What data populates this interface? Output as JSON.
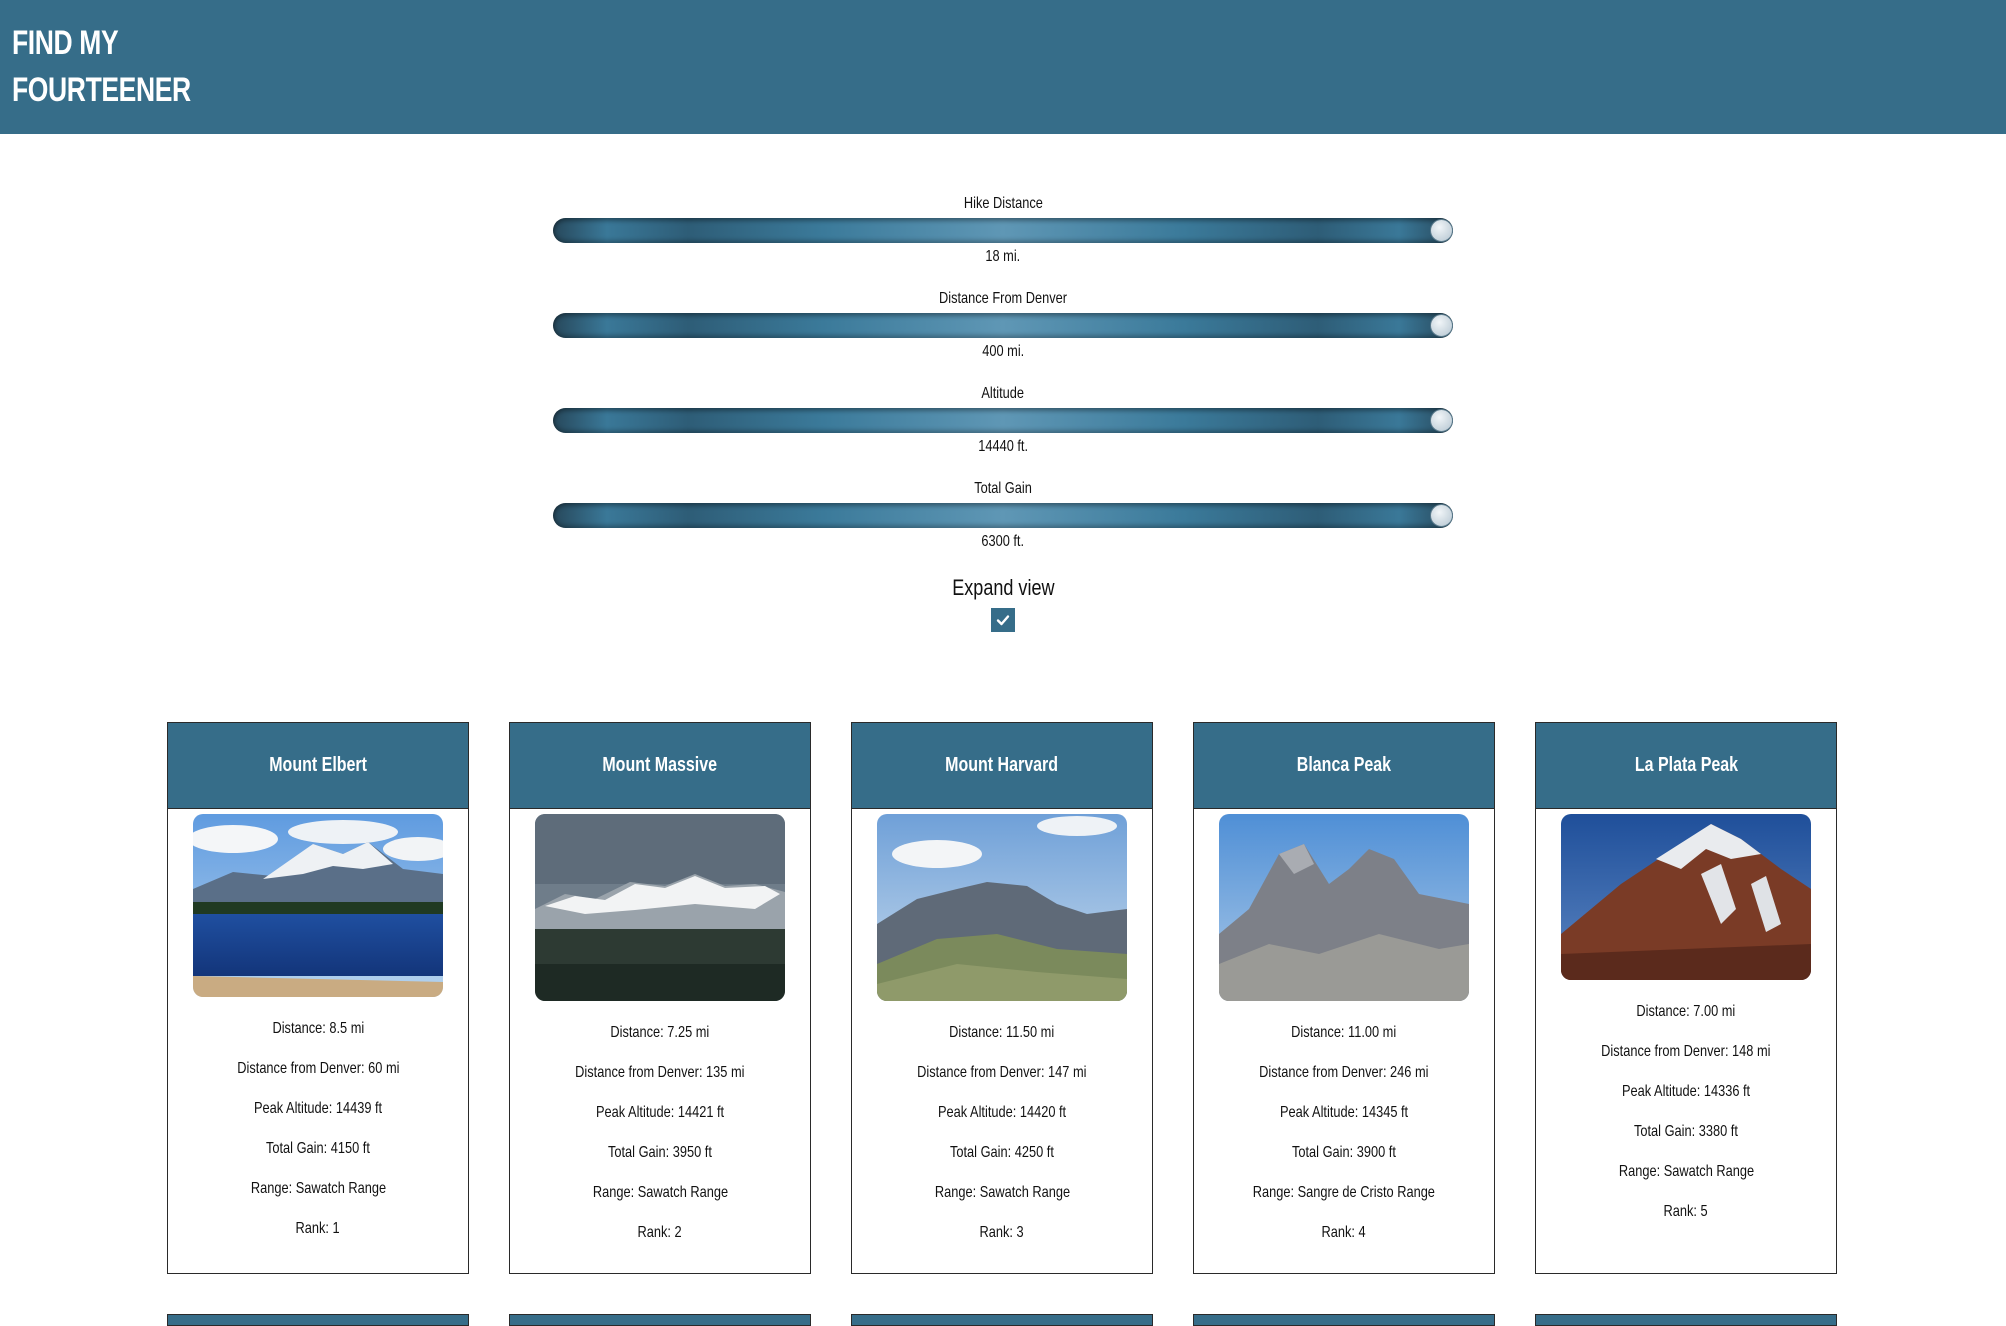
{
  "header": {
    "title_line1": "FIND MY",
    "title_line2": "FOURTEENER"
  },
  "sliders": [
    {
      "label": "Hike Distance",
      "value_text": "18 mi.",
      "fill": 1.0
    },
    {
      "label": "Distance From Denver",
      "value_text": "400 mi.",
      "fill": 1.0
    },
    {
      "label": "Altitude",
      "value_text": "14440 ft.",
      "fill": 1.0
    },
    {
      "label": "Total Gain",
      "value_text": "6300 ft.",
      "fill": 1.0
    }
  ],
  "expand": {
    "label": "Expand view",
    "checked": true
  },
  "cards": [
    {
      "name": "Mount Elbert",
      "distance": "Distance: 8.5 mi",
      "denver": "Distance from Denver: 60 mi",
      "altitude": "Peak Altitude: 14439 ft",
      "gain": "Total Gain: 4150 ft",
      "range": "Range: Sawatch Range",
      "rank": "Rank: 1"
    },
    {
      "name": "Mount Massive",
      "distance": "Distance: 7.25 mi",
      "denver": "Distance from Denver: 135 mi",
      "altitude": "Peak Altitude: 14421 ft",
      "gain": "Total Gain: 3950 ft",
      "range": "Range: Sawatch Range",
      "rank": "Rank: 2"
    },
    {
      "name": "Mount Harvard",
      "distance": "Distance: 11.50 mi",
      "denver": "Distance from Denver: 147 mi",
      "altitude": "Peak Altitude: 14420 ft",
      "gain": "Total Gain: 4250 ft",
      "range": "Range: Sawatch Range",
      "rank": "Rank: 3"
    },
    {
      "name": "Blanca Peak",
      "distance": "Distance: 11.00 mi",
      "denver": "Distance from Denver: 246 mi",
      "altitude": "Peak Altitude: 14345 ft",
      "gain": "Total Gain: 3900 ft",
      "range": "Range: Sangre de Cristo Range",
      "rank": "Rank: 4"
    },
    {
      "name": "La Plata Peak",
      "distance": "Distance: 7.00 mi",
      "denver": "Distance from Denver: 148 mi",
      "altitude": "Peak Altitude: 14336 ft",
      "gain": "Total Gain: 3380 ft",
      "range": "Range: Sawatch Range",
      "rank": "Rank: 5"
    }
  ],
  "colors": {
    "primary": "#366d89",
    "check": "#ffffff"
  }
}
